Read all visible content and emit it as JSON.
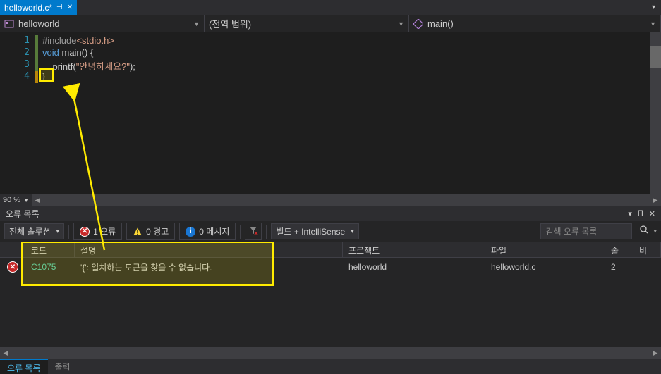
{
  "tab": {
    "filename": "helloworld.c*"
  },
  "nav": {
    "scope": "helloworld",
    "class": "(전역 범위)",
    "member": "main()"
  },
  "code": {
    "lines": [
      "1",
      "2",
      "3",
      "4"
    ],
    "l1_pp": "#include",
    "l1_inc": "<stdio.h>",
    "l2_kw1": "void",
    "l2_fn": "main",
    "l2_rest": "() {",
    "l3_fn": "printf",
    "l3_p1": "(",
    "l3_str": "\"안녕하세요?\"",
    "l3_p2": ");",
    "l4": "}"
  },
  "zoom": "90 %",
  "panel_title": "오류 목록",
  "toolbar": {
    "solution": "전체 솔루션",
    "errors": "1 오류",
    "warnings": "0 경고",
    "messages": "0 메시지",
    "build_filter": "빌드 + IntelliSense",
    "search_placeholder": "검색 오류 목록"
  },
  "grid": {
    "h_code": "코드",
    "h_desc": "설명",
    "h_proj": "프로젝트",
    "h_file": "파일",
    "h_line": "줄",
    "h_sup": "비",
    "row": {
      "code": "C1075",
      "desc": "'{': 일치하는 토큰을 찾을 수 없습니다.",
      "proj": "helloworld",
      "file": "helloworld.c",
      "line": "2"
    }
  },
  "bottom_tabs": {
    "errors": "오류 목록",
    "output": "출력"
  }
}
